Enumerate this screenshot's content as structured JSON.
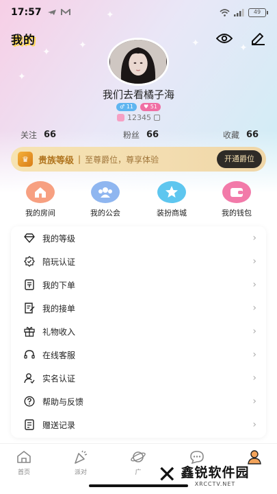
{
  "status_bar": {
    "time": "17:57",
    "battery": "49"
  },
  "header": {
    "title": "我的"
  },
  "profile": {
    "username": "我们去看橘子海",
    "badge_level_1": "11",
    "badge_level_2": "51",
    "user_id": "12345"
  },
  "stats": [
    {
      "label": "关注",
      "value": "66"
    },
    {
      "label": "粉丝",
      "value": "66"
    },
    {
      "label": "收藏",
      "value": "66"
    }
  ],
  "vip": {
    "title": "贵族等级",
    "separator": "|",
    "description": "至尊爵位，尊享体验",
    "button": "开通爵位"
  },
  "shortcuts": [
    {
      "label": "我的房间",
      "icon": "house-icon",
      "color": "#f7a081"
    },
    {
      "label": "我的公会",
      "icon": "group-icon",
      "color": "#8fb6f0"
    },
    {
      "label": "装扮商城",
      "icon": "star-icon",
      "color": "#5ec6ef"
    },
    {
      "label": "我的钱包",
      "icon": "wallet-icon",
      "color": "#f27aa9"
    }
  ],
  "menu": [
    {
      "label": "我的等级",
      "icon": "diamond-icon"
    },
    {
      "label": "陪玩认证",
      "icon": "certified-badge-icon"
    },
    {
      "label": "我的下单",
      "icon": "order-icon"
    },
    {
      "label": "我的接单",
      "icon": "receive-order-icon"
    },
    {
      "label": "礼物收入",
      "icon": "gift-icon"
    },
    {
      "label": "在线客服",
      "icon": "headset-icon"
    },
    {
      "label": "实名认证",
      "icon": "user-verify-icon"
    },
    {
      "label": "帮助与反馈",
      "icon": "help-icon"
    },
    {
      "label": "赠送记录",
      "icon": "record-icon"
    }
  ],
  "tabbar": [
    {
      "label": "首页",
      "icon": "home-icon"
    },
    {
      "label": "派对",
      "icon": "party-icon"
    },
    {
      "label": "广",
      "icon": "planet-icon"
    },
    {
      "label": "",
      "icon": "chat-icon"
    },
    {
      "label": "",
      "icon": "profile-icon"
    }
  ],
  "watermark": {
    "main": "鑫锐软件园",
    "sub": "XRCCTV.NET"
  },
  "colors": {
    "accent_gold": "#b0741e",
    "vip_button_bg": "#2e2b27"
  }
}
